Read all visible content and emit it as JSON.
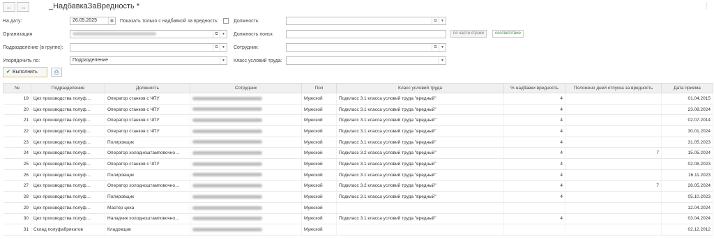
{
  "title": "_НадбавкаЗаВредность *",
  "nav": {
    "back": "←",
    "forward": "→",
    "more": "⋮"
  },
  "form": {
    "date_label": "На дату:",
    "date_value": "26.05.2025",
    "only_label": "Показать только с надбавкой за вредность:",
    "position_label": "Должность:",
    "org_label": "Организация",
    "position_search_label": "Должность поиск:",
    "seg_part": "по части строки",
    "seg_match": "соответствие",
    "dept_label": "Подразделение (в группе):",
    "employee_label": "Сотрудник:",
    "order_label": "Упорядочить по:",
    "order_value": "Подразделение",
    "class_label": "Класс условий труда:"
  },
  "toolbar": {
    "run_label": "Выполнить"
  },
  "table": {
    "headers": [
      "№",
      "Подразделение",
      "Должность",
      "Сотрудник",
      "Пол",
      "Класс условий труда",
      "% надбавки вредность",
      "Положено дней отпуска за вредность",
      "Дата приема"
    ],
    "rows": [
      [
        "19",
        "Цех производства полуф…",
        "Оператор станков с ЧПУ",
        "Мужской",
        "Подкласс 3.1 класса условий труда \"вредный\"",
        "4",
        "",
        "01.04.2015"
      ],
      [
        "20",
        "Цех производства полуф…",
        "Оператор станков с ЧПУ",
        "Мужской",
        "Подкласс 3.1 класса условий труда \"вредный\"",
        "4",
        "",
        "23.08.2024"
      ],
      [
        "21",
        "Цех производства полуф…",
        "Оператор станков с ЧПУ",
        "Мужской",
        "Подкласс 3.1 класса условий труда \"вредный\"",
        "4",
        "",
        "02.07.2014"
      ],
      [
        "22",
        "Цех производства полуф…",
        "Оператор станков с ЧПУ",
        "Мужской",
        "Подкласс 3.1 класса условий труда \"вредный\"",
        "4",
        "",
        "30.01.2024"
      ],
      [
        "23",
        "Цех производства полуф…",
        "Полировщик",
        "Мужской",
        "Подкласс 3.1 класса условий труда \"вредный\"",
        "4",
        "",
        "31.05.2023"
      ],
      [
        "24",
        "Цех производства полуф…",
        "Оператор холодноштамповочно…",
        "Мужской",
        "Подкласс 3.2 класса условий труда \"вредный\"",
        "4",
        "7",
        "15.05.2024"
      ],
      [
        "25",
        "Цех производства полуф…",
        "Оператор станков с ЧПУ",
        "Мужской",
        "Подкласс 3.1 класса условий труда \"вредный\"",
        "4",
        "",
        "02.08.2023"
      ],
      [
        "26",
        "Цех производства полуф…",
        "Полировщик",
        "Мужской",
        "Подкласс 3.1 класса условий труда \"вредный\"",
        "4",
        "",
        "16.11.2023"
      ],
      [
        "27",
        "Цех производства полуф…",
        "Оператор холодноштамповочно…",
        "Мужской",
        "Подкласс 3.2 класса условий труда \"вредный\"",
        "4",
        "7",
        "28.05.2024"
      ],
      [
        "28",
        "Цех производства полуф…",
        "Полировщик",
        "Мужской",
        "Подкласс 3.1 класса условий труда \"вредный\"",
        "4",
        "",
        "05.10.2023"
      ],
      [
        "29",
        "Цех производства полуф…",
        "Мастер цеха",
        "Мужской",
        "",
        "",
        "",
        "12.04.2024"
      ],
      [
        "30",
        "Цех производства полуф…",
        "Наладчик холодноштамповочно…",
        "Мужской",
        "Подкласс 3.1 класса условий труда \"вредный\"",
        "4",
        "",
        "03.04.2024"
      ],
      [
        "31",
        "Склад полуфабрикатов",
        "Кладовщик",
        "Мужской",
        "",
        "",
        "",
        "02.12.2012"
      ]
    ]
  }
}
